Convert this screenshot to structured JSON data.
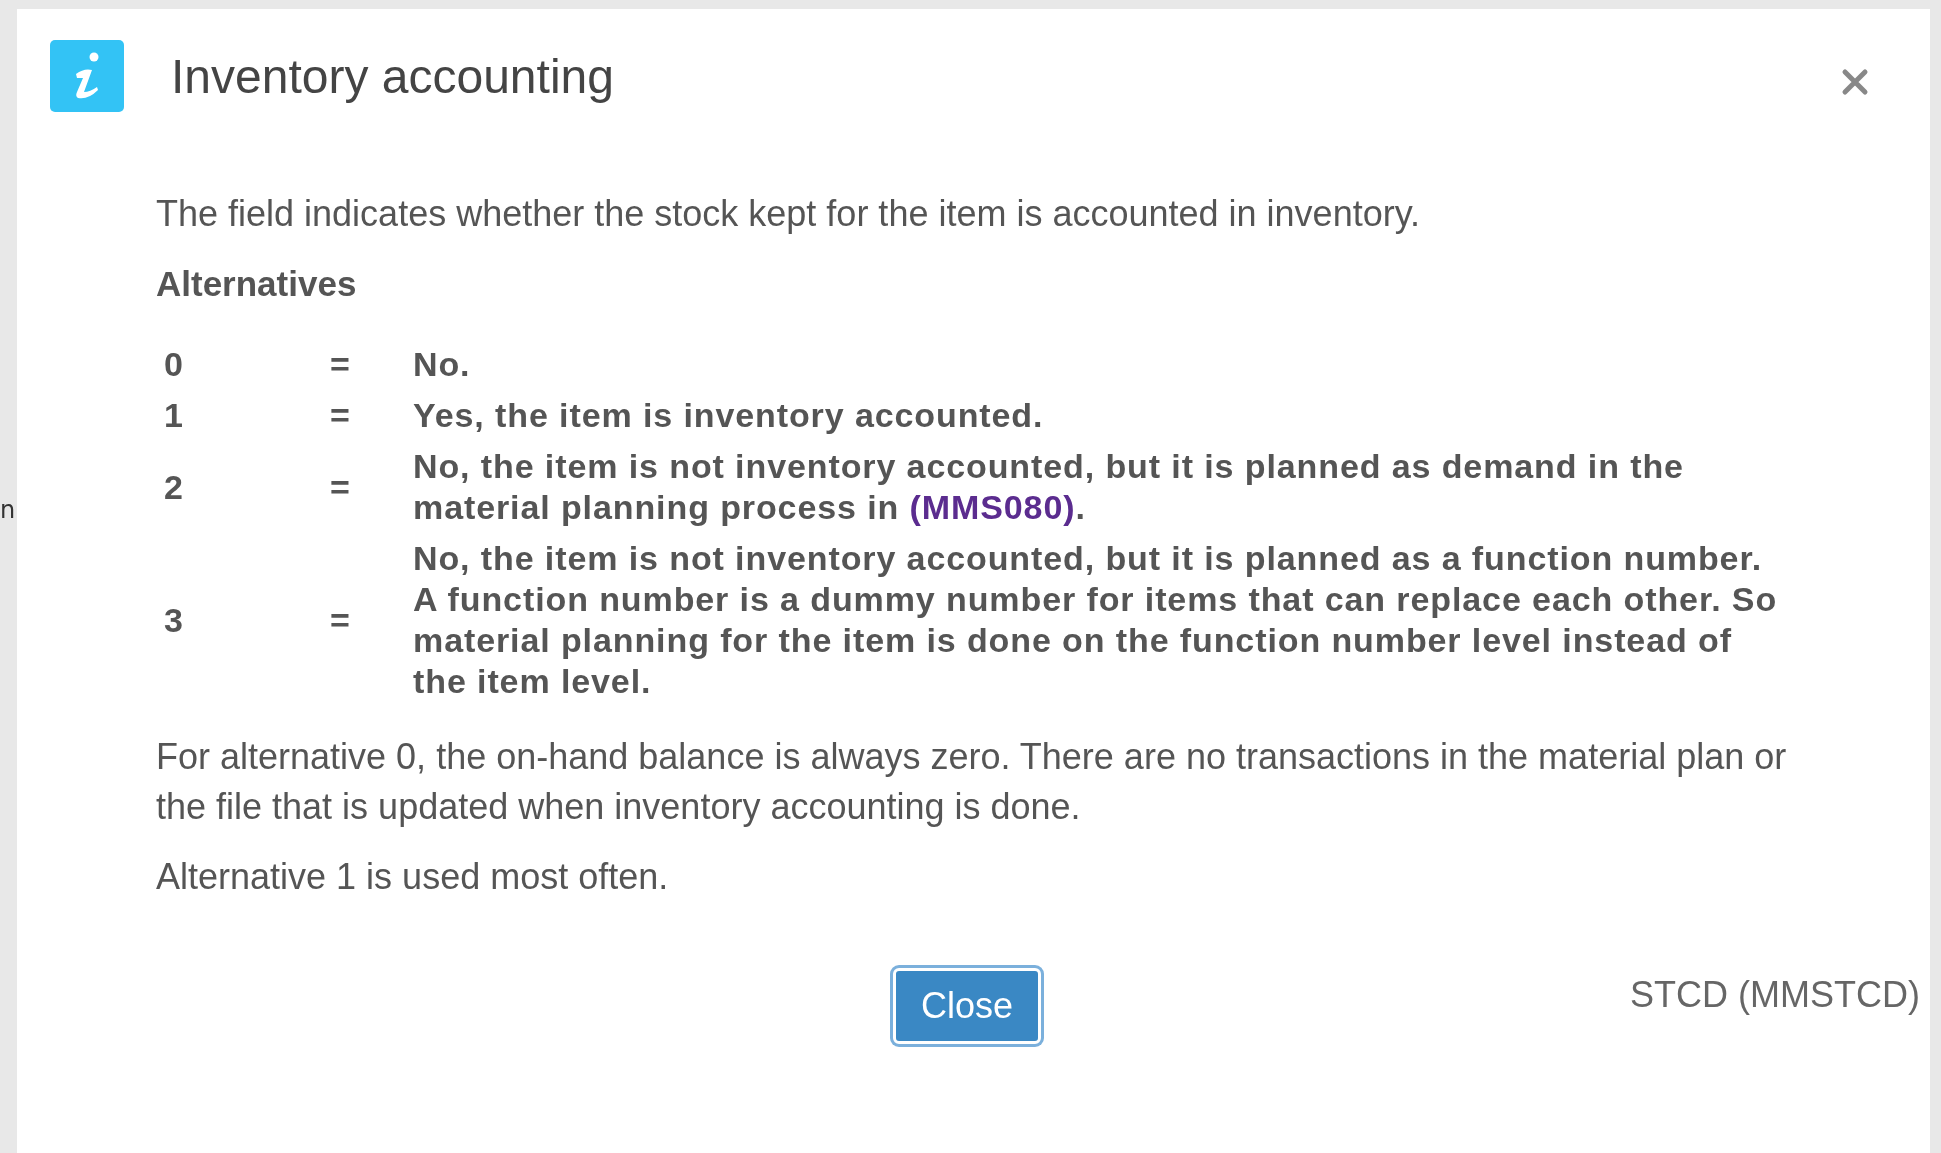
{
  "background_text": "n",
  "dialog": {
    "title": "Inventory accounting",
    "intro": "The field indicates whether the stock kept for the item is accounted in inventory.",
    "alternatives_heading": "Alternatives",
    "alternatives": [
      {
        "value": "0",
        "sign": "=",
        "description": "No."
      },
      {
        "value": "1",
        "sign": "=",
        "description": "Yes, the item is inventory accounted."
      },
      {
        "value": "2",
        "sign": "=",
        "description": "No, the item is not inventory accounted, but it is planned as demand in the material planning process in ",
        "link": "(MMS080)",
        "suffix": "."
      },
      {
        "value": "3",
        "sign": "=",
        "description": "No, the item is not inventory accounted, but it is planned as a function number. A function number is a dummy number for items that can replace each other. So material planning for the item is done on the function number level instead of the item level."
      }
    ],
    "paragraphs": [
      "For alternative 0, the on-hand balance is always zero. There are no transactions in the material plan or the file that is updated when inventory accounting is done.",
      "Alternative 1 is used most often."
    ],
    "close_button": "Close",
    "field_code": "STCD (MMSTCD)"
  }
}
